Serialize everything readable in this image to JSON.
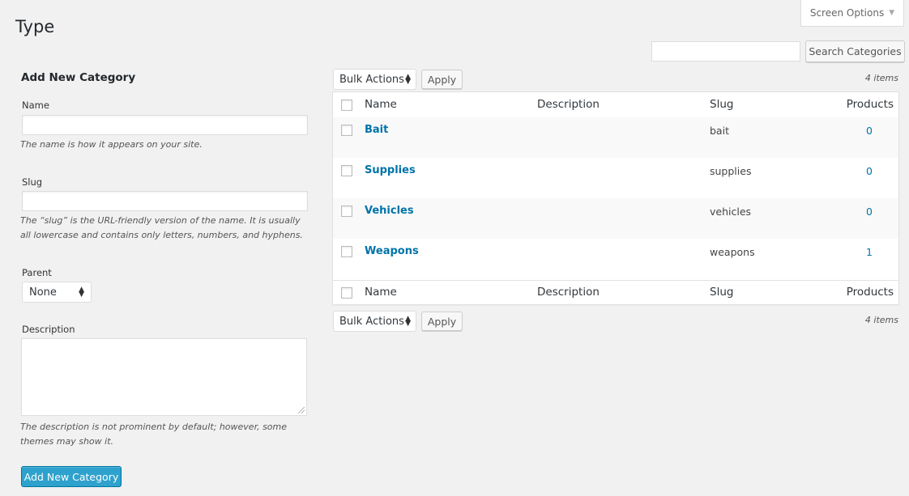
{
  "header": {
    "screen_options": "Screen Options",
    "title": "Type"
  },
  "search": {
    "value": "",
    "button": "Search Categories"
  },
  "form": {
    "heading": "Add New Category",
    "name_label": "Name",
    "name_value": "",
    "name_help": "The name is how it appears on your site.",
    "slug_label": "Slug",
    "slug_value": "",
    "slug_help": "The “slug” is the URL-friendly version of the name. It is usually all lowercase and contains only letters, numbers, and hyphens.",
    "parent_label": "Parent",
    "parent_value": "None",
    "description_label": "Description",
    "description_help": "The description is not prominent by default; however, some themes may show it.",
    "submit": "Add New Category"
  },
  "table": {
    "bulk_actions": "Bulk Actions",
    "apply": "Apply",
    "items_count": "4 items",
    "columns": [
      "Name",
      "Description",
      "Slug",
      "Products"
    ],
    "rows": [
      {
        "name": "Bait",
        "description": "",
        "slug": "bait",
        "products": "0"
      },
      {
        "name": "Supplies",
        "description": "",
        "slug": "supplies",
        "products": "0"
      },
      {
        "name": "Vehicles",
        "description": "",
        "slug": "vehicles",
        "products": "0"
      },
      {
        "name": "Weapons",
        "description": "",
        "slug": "weapons",
        "products": "1"
      }
    ]
  },
  "colors": {
    "primary": "#2ea2cc",
    "link": "#0073aa",
    "background": "#f1f1f1"
  }
}
